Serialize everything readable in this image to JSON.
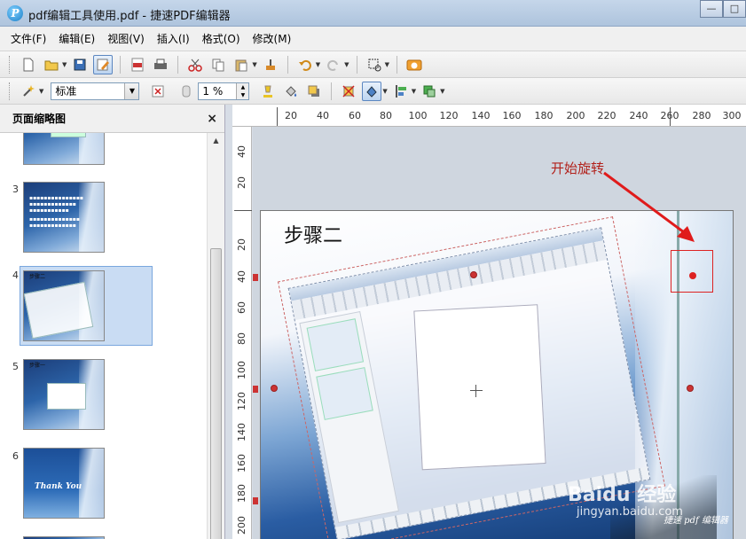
{
  "window": {
    "app_icon_glyph": "P",
    "title": "pdf编辑工具使用.pdf - 捷速PDF编辑器",
    "controls": {
      "minimize": "—",
      "maximize": "□"
    }
  },
  "menu": [
    {
      "id": "file",
      "label": "文件(F)"
    },
    {
      "id": "edit",
      "label": "编辑(E)"
    },
    {
      "id": "view",
      "label": "视图(V)"
    },
    {
      "id": "insert",
      "label": "插入(I)"
    },
    {
      "id": "format",
      "label": "格式(O)"
    },
    {
      "id": "modify",
      "label": "修改(M)"
    }
  ],
  "toolbar2": {
    "style_select": "标准",
    "zoom_value": "1 %"
  },
  "thumbnail_panel": {
    "title": "页面缩略图",
    "close_glyph": "×",
    "pages": [
      {
        "num": "",
        "selected": false,
        "variant": "top-partial"
      },
      {
        "num": "3",
        "selected": false,
        "variant": "text"
      },
      {
        "num": "4",
        "selected": true,
        "variant": "step-rotated",
        "label": "步骤二"
      },
      {
        "num": "5",
        "selected": false,
        "variant": "step-window",
        "label": "步骤一"
      },
      {
        "num": "6",
        "selected": false,
        "variant": "thanks",
        "label": "Thank You"
      }
    ]
  },
  "ruler": {
    "corner_glyph": "┼",
    "h_labels": [
      "20",
      "40",
      "60",
      "80",
      "100",
      "120",
      "140",
      "160",
      "180",
      "200",
      "220",
      "240",
      "260",
      "280",
      "300"
    ],
    "v_labels_above": [
      "40",
      "20"
    ],
    "v_labels": [
      "20",
      "40",
      "60",
      "80",
      "100",
      "120",
      "140",
      "160",
      "180",
      "200"
    ]
  },
  "canvas": {
    "page_title": "步骤二",
    "annotation": "开始旋转",
    "watermark": "Baidu 经验",
    "watermark_sub": "jingyan.baidu.com",
    "watermark_credit": "捷速 pdf 编辑器"
  },
  "colors": {
    "annotation": "#b2211b",
    "handle": "#cc3333",
    "selection": "#5b86c0"
  }
}
